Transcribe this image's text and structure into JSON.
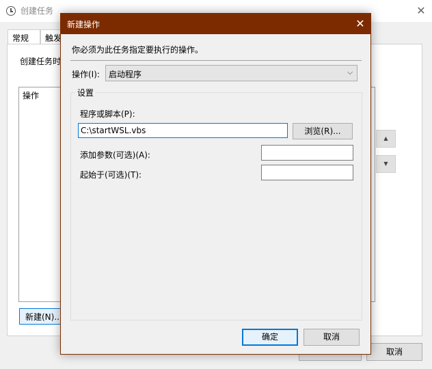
{
  "parent_window": {
    "title": "创建任务",
    "close_glyph": "✕",
    "tabs": [
      "常规",
      "触发"
    ],
    "description": "创建任务时",
    "actions_list": {
      "column_header": "操作"
    },
    "move_up_glyph": "▲",
    "move_down_glyph": "▼",
    "new_button": "新建(N)...",
    "ok_button": "",
    "cancel_button": "取消"
  },
  "dialog": {
    "title": "新建操作",
    "close_glyph": "✕",
    "instruction": "你必须为此任务指定要执行的操作。",
    "action_label": "操作(I):",
    "action_selected": "启动程序",
    "chevron_glyph": "⌵",
    "settings": {
      "legend": "设置",
      "script_label": "程序或脚本(P):",
      "script_value": "C:\\startWSL.vbs",
      "browse_button": "浏览(R)...",
      "args_label": "添加参数(可选)(A):",
      "args_value": "",
      "start_in_label": "起始于(可选)(T):",
      "start_in_value": ""
    },
    "ok_button": "确定",
    "cancel_button": "取消"
  },
  "colors": {
    "dialog_titlebar": "#7c2b00",
    "focus_border": "#0078d7",
    "window_background": "#f0f0f0"
  }
}
